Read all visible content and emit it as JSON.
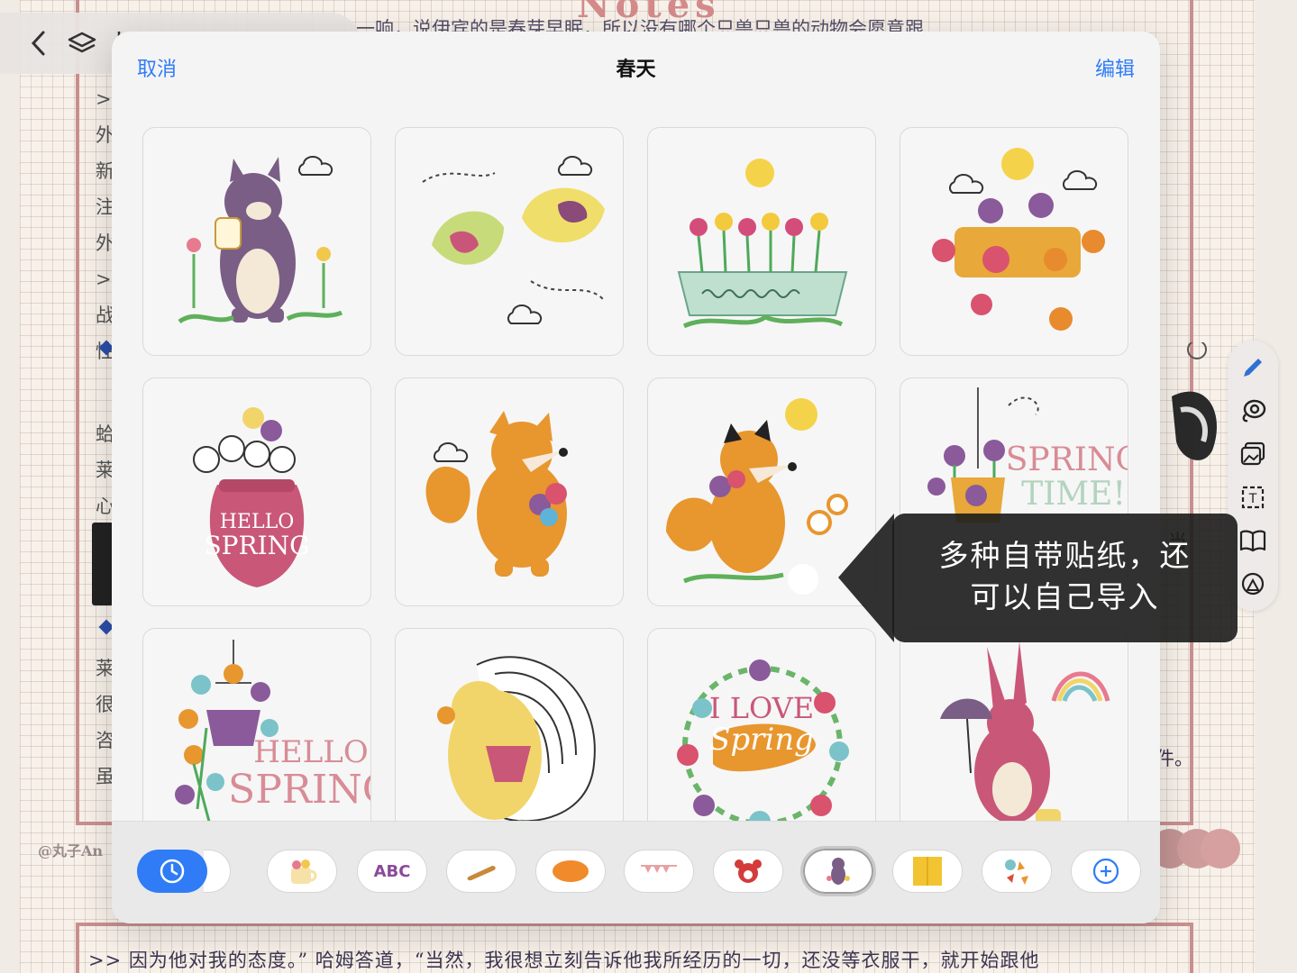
{
  "background": {
    "heading": "Notes",
    "top_line": "一响，说伊宾的是春芽早眠，所以没有哪个只兽只兽的动物会愿意跟",
    "bottom_line": ">> 因为他对我的态度。” 哈姆答道，“当然，我很想立刻告诉他我所经历的一切，还没等衣服干，就开始跟他",
    "watermark": "@丸子An",
    "side_glyphs": [
      ">",
      "外",
      "新",
      "注",
      "外",
      ">",
      "战",
      "性"
    ],
    "side_glyphs_lower": [
      "蛤",
      "莱",
      "心",
      "莱",
      "很",
      "咨",
      "虽"
    ],
    "right_glyphs": [
      "当",
      "件。"
    ]
  },
  "toolbar": {
    "icons": [
      "back-chevron-icon",
      "layers-icon",
      "undo-icon"
    ]
  },
  "tool_rail": {
    "tools": [
      "pen-icon",
      "lasso-icon",
      "image-icon",
      "text-icon",
      "book-icon",
      "shapes-icon"
    ]
  },
  "modal": {
    "cancel_label": "取消",
    "title": "春天",
    "edit_label": "编辑",
    "stickers": [
      {
        "name": "bear-with-honey-jar"
      },
      {
        "name": "two-birds"
      },
      {
        "name": "flower-planter"
      },
      {
        "name": "flower-bunch"
      },
      {
        "name": "hello-spring-vase",
        "text": [
          "HELLO",
          "SPRING"
        ]
      },
      {
        "name": "fox-with-bouquet"
      },
      {
        "name": "fox-with-flowers"
      },
      {
        "name": "spring-time-hanging-plant",
        "text": [
          "SPRING",
          "TIME!"
        ]
      },
      {
        "name": "hello-spring-hanging-basket",
        "text": [
          "HELLO",
          "SPRING"
        ]
      },
      {
        "name": "hedgehog-with-basket"
      },
      {
        "name": "i-love-spring-wreath",
        "text": [
          "I LOVE",
          "Spring"
        ]
      },
      {
        "name": "bunny-with-umbrella"
      }
    ]
  },
  "category_bar": {
    "categories": [
      {
        "name": "recent-clock-icon",
        "selected": false
      },
      {
        "name": "flower-mug-icon",
        "selected": false
      },
      {
        "name": "abc-letters-icon",
        "text": "ABC",
        "selected": false
      },
      {
        "name": "baguette-icon",
        "selected": false
      },
      {
        "name": "orange-blob-icon",
        "selected": false
      },
      {
        "name": "bunting-icon",
        "selected": false
      },
      {
        "name": "red-creature-icon",
        "selected": false
      },
      {
        "name": "spring-bear-icon",
        "selected": true
      },
      {
        "name": "yellow-notes-icon",
        "selected": false
      },
      {
        "name": "autumn-leaves-icon",
        "selected": false
      },
      {
        "name": "add-icon",
        "selected": false
      }
    ]
  },
  "callout": {
    "line1": "多种自带贴纸，还",
    "line2": "可以自己导入"
  },
  "colors": {
    "accent_blue": "#2f7cf6",
    "frame_red": "#c98f8f"
  }
}
